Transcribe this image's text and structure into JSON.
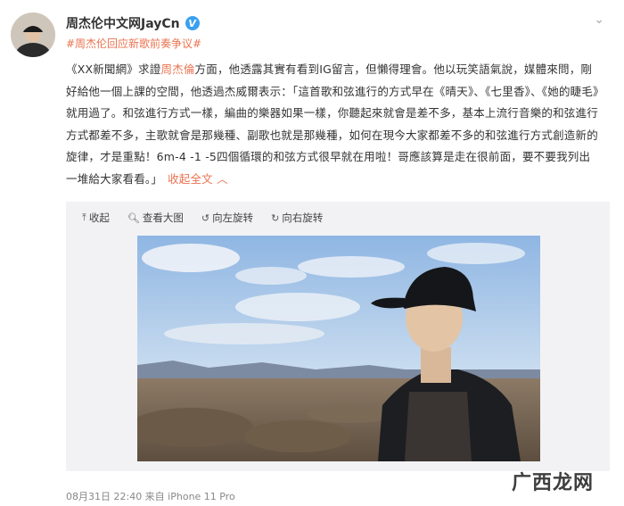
{
  "author": {
    "name": "周杰伦中文网JayCn",
    "verified_badge": "V"
  },
  "topic": "#周杰伦回应新歌前奏争议#",
  "post": {
    "part1": "《XX新聞網》求證",
    "mention": "周杰倫",
    "part2": "方面，他透露其實有看到IG留言，但懶得理會。他以玩笑語氣說，媒體來問，剛好給他一個上課的空間，他透過杰威爾表示：「這首歌和弦進行的方式早在《晴天》、《七里香》、《她的睫毛》就用過了。和弦進行方式一樣，編曲的樂器如果一樣，你聽起來就會是差不多，基本上流行音樂的和弦進行方式都差不多，主歌就會是那幾種、副歌也就是那幾種，如何在現今大家都差不多的和弦進行方式創造新的旋律，才是重點！6m-4 -1 -5四個循環的和弦方式很早就在用啦！哥應該算是走在很前面，要不要我列出一堆給大家看看。」",
    "collapse_label": "收起全文"
  },
  "media_toolbar": [
    {
      "icon": "collapse-icon",
      "label": "收起"
    },
    {
      "icon": "search-icon",
      "label": "查看大图"
    },
    {
      "icon": "rotate-left-icon",
      "label": "向左旋转"
    },
    {
      "icon": "rotate-right-icon",
      "label": "向右旋转"
    }
  ],
  "footer": "08月31日 22:40  来自 iPhone 11 Pro",
  "watermark": "广西龙网",
  "colors": {
    "accent": "#eb7350",
    "verified": "#3aa0f0",
    "media_bg": "#f2f2f5"
  }
}
